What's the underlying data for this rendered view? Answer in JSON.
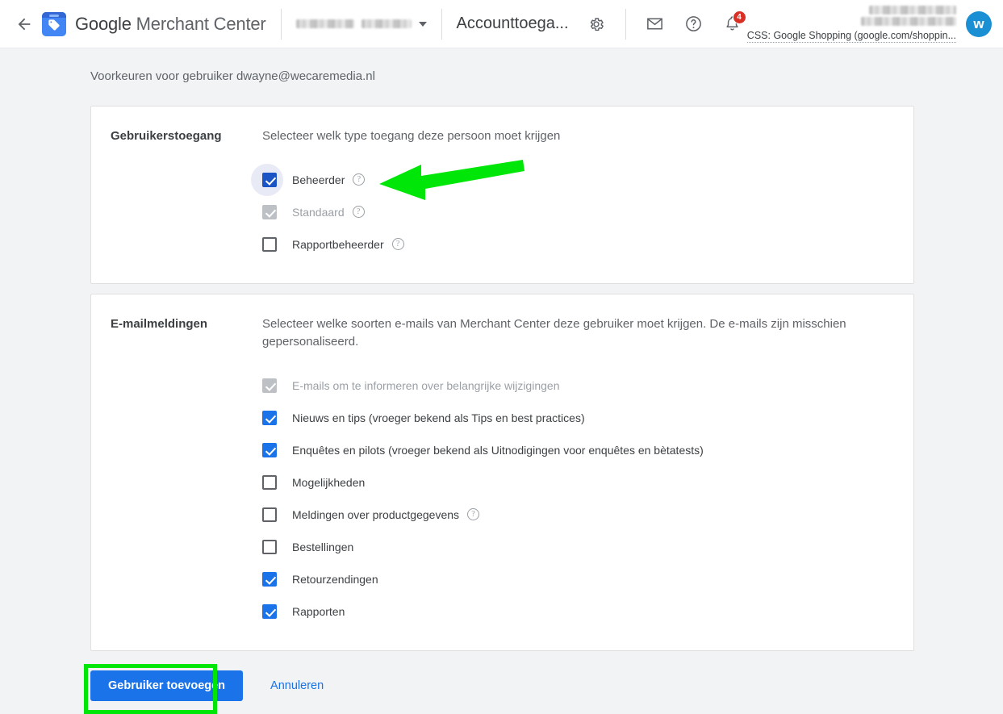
{
  "header": {
    "back_icon": "back-arrow-icon",
    "brand_google": "Google",
    "brand_rest": " Merchant Center",
    "logo_icon": "merchant-center-tag-icon",
    "account_caret_icon": "chevron-down-icon",
    "page_tab": "Accounttoega...",
    "gear_icon": "gear-icon",
    "mail_icon": "envelope-icon",
    "help_icon": "help-circle-icon",
    "bell_icon": "bell-icon",
    "bell_badge": "4",
    "css_line": "CSS: Google Shopping (google.com/shoppin...",
    "avatar_letter": "w"
  },
  "page": {
    "subtitle": "Voorkeuren voor gebruiker dwayne@wecaremedia.nl"
  },
  "access_card": {
    "label": "Gebruikerstoegang",
    "description": "Selecteer welk type toegang deze persoon moet krijgen",
    "options": [
      {
        "label": "Beheerder",
        "checked": true,
        "disabled": false,
        "focused": true,
        "help": true
      },
      {
        "label": "Standaard",
        "checked": true,
        "disabled": true,
        "focused": false,
        "help": true
      },
      {
        "label": "Rapportbeheerder",
        "checked": false,
        "disabled": false,
        "focused": false,
        "help": true
      }
    ]
  },
  "email_card": {
    "label": "E-mailmeldingen",
    "description": "Selecteer welke soorten e-mails van Merchant Center deze gebruiker moet krijgen. De e-mails zijn misschien gepersonaliseerd.",
    "options": [
      {
        "label": "E-mails om te informeren over belangrijke wijzigingen",
        "checked": true,
        "disabled": true,
        "help": false
      },
      {
        "label": "Nieuws en tips (vroeger bekend als Tips en best practices)",
        "checked": true,
        "disabled": false,
        "help": false
      },
      {
        "label": "Enquêtes en pilots (vroeger bekend als Uitnodigingen voor enquêtes en bètatests)",
        "checked": true,
        "disabled": false,
        "help": false
      },
      {
        "label": "Mogelijkheden",
        "checked": false,
        "disabled": false,
        "help": false
      },
      {
        "label": "Meldingen over productgegevens",
        "checked": false,
        "disabled": false,
        "help": true
      },
      {
        "label": "Bestellingen",
        "checked": false,
        "disabled": false,
        "help": false
      },
      {
        "label": "Retourzendingen",
        "checked": true,
        "disabled": false,
        "help": false
      },
      {
        "label": "Rapporten",
        "checked": true,
        "disabled": false,
        "help": false
      }
    ]
  },
  "actions": {
    "primary_label": "Gebruiker toevoegen",
    "cancel_label": "Annuleren"
  },
  "annotations": {
    "arrow_icon": "green-left-arrow-annotation",
    "box_icon": "green-highlight-box-annotation",
    "green": "#00e609"
  },
  "colors": {
    "accent_blue": "#1a73e8",
    "badge_red": "#d93025",
    "avatar_blue": "#1a8fd4"
  }
}
